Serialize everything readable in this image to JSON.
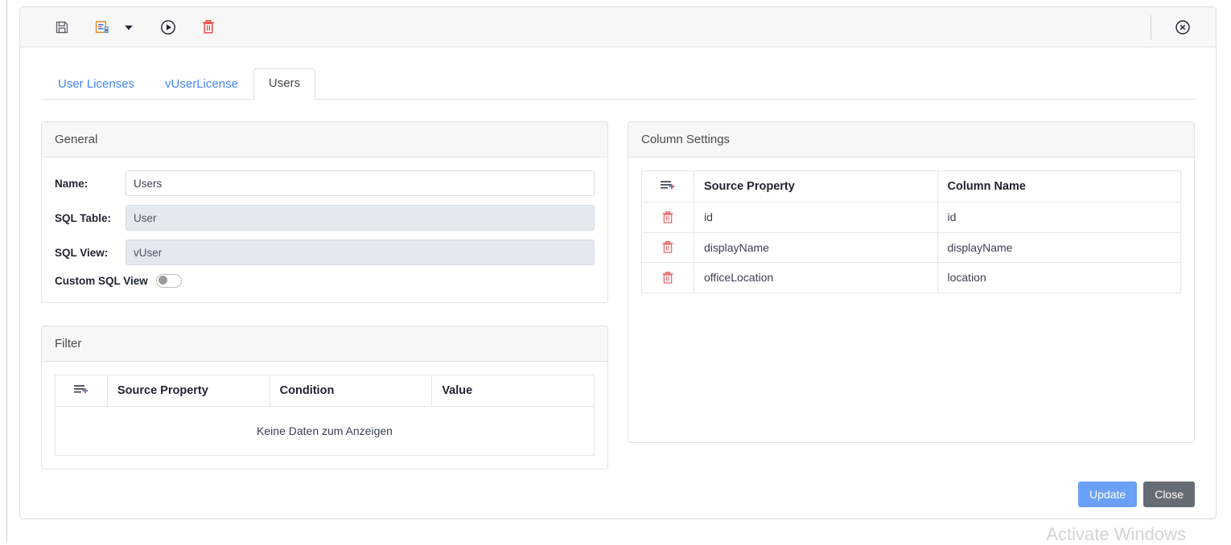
{
  "toolbar": {
    "save_label": "Save",
    "save_as_label": "Save As",
    "save_as_caret_label": "Save As options",
    "run_label": "Run",
    "delete_label": "Delete",
    "close_label": "Close"
  },
  "tabs": [
    {
      "label": "User Licenses",
      "active": false
    },
    {
      "label": "vUserLicense",
      "active": false
    },
    {
      "label": "Users",
      "active": true
    }
  ],
  "general": {
    "title": "General",
    "name_label": "Name:",
    "name_value": "Users",
    "name_placeholder": "",
    "sql_table_label": "SQL Table:",
    "sql_table_value": "User",
    "sql_view_label": "SQL View:",
    "sql_view_value": "vUser",
    "custom_sql_view_label": "Custom SQL View",
    "custom_sql_view_on": false
  },
  "filter": {
    "title": "Filter",
    "add_row_icon": "add-row-icon",
    "headers": [
      "Source Property",
      "Condition",
      "Value"
    ],
    "rows": [],
    "empty_text": "Keine Daten zum Anzeigen"
  },
  "column_settings": {
    "title": "Column Settings",
    "add_row_icon": "add-row-icon",
    "headers": [
      "Source Property",
      "Column Name"
    ],
    "rows": [
      {
        "source_property": "id",
        "column_name": "id"
      },
      {
        "source_property": "displayName",
        "column_name": "displayName"
      },
      {
        "source_property": "officeLocation",
        "column_name": "location"
      }
    ]
  },
  "footer": {
    "update_label": "Update",
    "close_label": "Close"
  },
  "watermark": {
    "line1": "Activate Windows"
  },
  "colors": {
    "accent_blue": "#4285f4",
    "primary_button": "#6aa0f5",
    "secondary_button": "#666c73",
    "delete_red": "#e8504a",
    "row_delete_red": "#ec6b6b",
    "panel_header_bg": "#f7f7f7"
  }
}
